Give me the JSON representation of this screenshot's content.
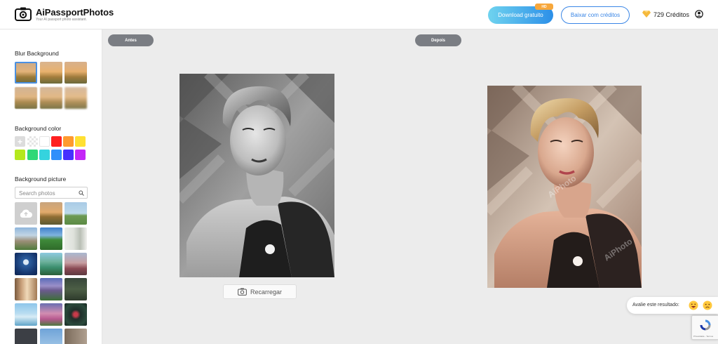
{
  "header": {
    "brand_title": "AiPassportPhotos",
    "brand_subtitle": "Your AI passport photo assistant.",
    "download_label": "Download gratuito",
    "download_badge": "HD",
    "credits_button_label": "Baixar com créditos",
    "credits_count": "729 Créditos",
    "icons": [
      "camera-logo-icon",
      "gem-icon",
      "user-icon"
    ]
  },
  "sidebar": {
    "blur_title": "Blur Background",
    "blur_thumbs_count": 6,
    "color_title": "Background color",
    "colors": [
      "#ffffff",
      "#ff2020",
      "#ff9a2e",
      "#ffe033",
      "#b4e81e",
      "#2ed877",
      "#35d3de",
      "#2f8ffb",
      "#4630ff",
      "#c426f7"
    ],
    "picture_title": "Background picture",
    "search_placeholder": "Search photos",
    "upload_icon": "cloud-upload-icon"
  },
  "main": {
    "before_label": "Antes",
    "after_label": "Depois",
    "reload_label": "Recarregar",
    "watermark": "AiPhoto",
    "rating_text": "Avalie este resultado:",
    "rating_icons": [
      "happy-face-icon",
      "sad-face-icon"
    ],
    "recaptcha_text": "Privacidade - Termos"
  },
  "colors": {
    "accent": "#3a86e6",
    "pill": "#7a7d83",
    "badge": "#f7a73b"
  }
}
